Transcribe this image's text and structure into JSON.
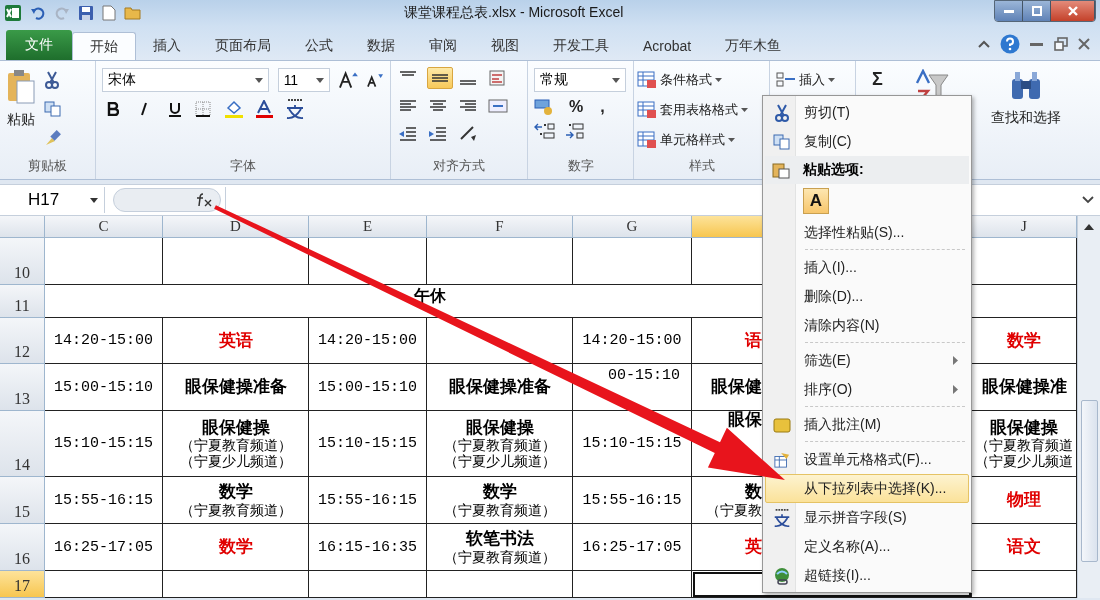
{
  "window": {
    "title": "课堂课程总表.xlsx - Microsoft Excel"
  },
  "tabs": [
    {
      "label": "文件",
      "kind": "file",
      "selected": false
    },
    {
      "label": "开始",
      "kind": "tab",
      "selected": true
    },
    {
      "label": "插入",
      "kind": "tab",
      "selected": false
    },
    {
      "label": "页面布局",
      "kind": "tab",
      "selected": false
    },
    {
      "label": "公式",
      "kind": "tab",
      "selected": false
    },
    {
      "label": "数据",
      "kind": "tab",
      "selected": false
    },
    {
      "label": "审阅",
      "kind": "tab",
      "selected": false
    },
    {
      "label": "视图",
      "kind": "tab",
      "selected": false
    },
    {
      "label": "开发工具",
      "kind": "tab",
      "selected": false
    },
    {
      "label": "Acrobat",
      "kind": "tab",
      "selected": false
    },
    {
      "label": "万年木鱼",
      "kind": "tab",
      "selected": false
    }
  ],
  "ribbon": {
    "clipboard": {
      "paste": "粘贴",
      "label": "剪贴板"
    },
    "font": {
      "name": "宋体",
      "size": "11",
      "label": "字体"
    },
    "alignment": {
      "label": "对齐方式",
      "center_selected": true
    },
    "number": {
      "format": "常规",
      "percent": "%",
      "comma": ",",
      "label": "数字"
    },
    "styles": {
      "buttons": [
        "条件格式",
        "套用表格格式",
        "单元格样式"
      ],
      "label": "样式"
    },
    "cells": {
      "insert": "插入"
    },
    "editing": {
      "sum": "Σ",
      "find": "查找和选择"
    }
  },
  "formula_bar": {
    "name_box": "H17"
  },
  "columns": [
    {
      "label": "C",
      "selected": false
    },
    {
      "label": "D",
      "selected": false
    },
    {
      "label": "E",
      "selected": false
    },
    {
      "label": "F",
      "selected": false
    },
    {
      "label": "G",
      "selected": false
    },
    {
      "selected": true
    },
    {
      "label": "J",
      "selected": false
    }
  ],
  "rows": [
    {
      "number": "10",
      "selected": false,
      "cells": [
        {
          "kind": "empty",
          "selected": false
        },
        {
          "kind": "empty",
          "selected": false
        },
        {
          "kind": "empty",
          "selected": false
        },
        {
          "kind": "empty",
          "selected": false
        },
        {
          "kind": "empty",
          "selected": false
        },
        {
          "kind": "empty",
          "selected": false
        },
        {
          "kind": "empty",
          "selected": false
        }
      ]
    },
    {
      "number": "11",
      "selected": false,
      "cells": [
        {
          "kind": "merged",
          "text": "午休",
          "selected": false
        }
      ]
    },
    {
      "number": "12",
      "selected": false,
      "cells": [
        {
          "kind": "time",
          "text": "14:20-15:00",
          "selected": false
        },
        {
          "kind": "subject",
          "text": "英语",
          "color": "#e00000",
          "selected": false
        },
        {
          "kind": "time",
          "text": "14:20-15:00",
          "selected": false
        },
        {
          "kind": "empty",
          "selected": false
        },
        {
          "kind": "time",
          "text": "14:20-15:00",
          "selected": false
        },
        {
          "kind": "subject",
          "text": "语",
          "color": "#e00000",
          "selected": false
        },
        {
          "kind": "subject",
          "text": "数学",
          "color": "#e00000",
          "selected": false
        }
      ]
    },
    {
      "number": "13",
      "selected": false,
      "cells": [
        {
          "kind": "time",
          "text": "15:00-15:10",
          "selected": false
        },
        {
          "kind": "subject",
          "text": "眼保健操准备",
          "color": "#000000",
          "selected": false
        },
        {
          "kind": "time",
          "text": "15:00-15:10",
          "selected": false
        },
        {
          "kind": "subject",
          "text": "眼保健操准备",
          "color": "#000000",
          "selected": false
        },
        {
          "kind": "partial",
          "text": "00-15:10",
          "selected": false
        },
        {
          "kind": "subject",
          "text": "眼保健",
          "color": "#000000",
          "selected": false
        },
        {
          "kind": "subject",
          "text": "眼保健操准",
          "color": "#000000",
          "selected": false
        }
      ]
    },
    {
      "number": "14",
      "selected": false,
      "cells": [
        {
          "kind": "time",
          "text": "15:10-15:15",
          "selected": false
        },
        {
          "kind": "subject",
          "text": "眼保健操",
          "color": "#000000",
          "notes": [
            "（宁夏教育频道）",
            "（宁夏少儿频道）"
          ],
          "selected": false
        },
        {
          "kind": "time",
          "text": "15:10-15:15",
          "selected": false
        },
        {
          "kind": "subject",
          "text": "眼保健操",
          "color": "#000000",
          "notes": [
            "（宁夏教育频道）",
            "（宁夏少儿频道）"
          ],
          "selected": false
        },
        {
          "kind": "time",
          "text": "15:10-15:15",
          "selected": false
        },
        {
          "kind": "partial",
          "text": "眼保",
          "selected": false
        },
        {
          "kind": "subject",
          "text": "眼保健操",
          "color": "#000000",
          "notes": [
            "（宁夏教育频道",
            "（宁夏少儿频道"
          ],
          "selected": false
        }
      ]
    },
    {
      "number": "15",
      "selected": false,
      "cells": [
        {
          "kind": "time",
          "text": "15:55-16:15",
          "selected": false
        },
        {
          "kind": "subject",
          "text": "数学",
          "color": "#000000",
          "notes": [
            "（宁夏教育频道）"
          ],
          "selected": false
        },
        {
          "kind": "time",
          "text": "15:55-16:15",
          "selected": false
        },
        {
          "kind": "subject",
          "text": "数学",
          "color": "#000000",
          "notes": [
            "（宁夏教育频道）"
          ],
          "selected": false
        },
        {
          "kind": "time",
          "text": "15:55-16:15",
          "selected": false
        },
        {
          "kind": "subject",
          "text": "数",
          "color": "#000000",
          "notes": [
            "（宁夏教"
          ],
          "selected": false
        },
        {
          "kind": "subject",
          "text": "物理",
          "color": "#e00000",
          "selected": false
        }
      ]
    },
    {
      "number": "16",
      "selected": false,
      "cells": [
        {
          "kind": "time",
          "text": "16:25-17:05",
          "selected": false
        },
        {
          "kind": "subject",
          "text": "数学",
          "color": "#e00000",
          "selected": false
        },
        {
          "kind": "time",
          "text": "16:15-16:35",
          "selected": false
        },
        {
          "kind": "subject",
          "text": "软笔书法",
          "color": "#000000",
          "notes": [
            "（宁夏教育频道）"
          ],
          "selected": false
        },
        {
          "kind": "time",
          "text": "16:25-17:05",
          "selected": false
        },
        {
          "kind": "subject",
          "text": "英",
          "color": "#e00000",
          "selected": false
        },
        {
          "kind": "subject",
          "text": "语文",
          "color": "#e00000",
          "selected": false
        }
      ]
    },
    {
      "number": "17",
      "selected": true,
      "cells": [
        {
          "kind": "empty",
          "selected": false
        },
        {
          "kind": "empty",
          "selected": false
        },
        {
          "kind": "empty",
          "selected": false
        },
        {
          "kind": "empty",
          "selected": false
        },
        {
          "kind": "empty",
          "selected": false
        },
        {
          "kind": "empty",
          "selected": true
        },
        {
          "kind": "empty",
          "selected": false
        }
      ]
    }
  ],
  "context_menu": {
    "items": [
      {
        "kind": "item",
        "label": "剪切(T)",
        "highlighted": false,
        "submenu": false
      },
      {
        "kind": "item",
        "label": "复制(C)",
        "highlighted": false,
        "submenu": false
      },
      {
        "kind": "header",
        "label": "粘贴选项:"
      },
      {
        "kind": "paste_button",
        "label": "A"
      },
      {
        "kind": "item",
        "label": "选择性粘贴(S)...",
        "highlighted": false,
        "submenu": false
      },
      {
        "kind": "separator"
      },
      {
        "kind": "item",
        "label": "插入(I)...",
        "highlighted": false,
        "submenu": false
      },
      {
        "kind": "item",
        "label": "删除(D)...",
        "highlighted": false,
        "submenu": false
      },
      {
        "kind": "item",
        "label": "清除内容(N)",
        "highlighted": false,
        "submenu": false
      },
      {
        "kind": "separator"
      },
      {
        "kind": "item",
        "label": "筛选(E)",
        "highlighted": false,
        "submenu": true
      },
      {
        "kind": "item",
        "label": "排序(O)",
        "highlighted": false,
        "submenu": true
      },
      {
        "kind": "separator"
      },
      {
        "kind": "item",
        "label": "插入批注(M)",
        "highlighted": false,
        "submenu": false
      },
      {
        "kind": "separator"
      },
      {
        "kind": "item",
        "label": "设置单元格格式(F)...",
        "highlighted": false,
        "submenu": false
      },
      {
        "kind": "item",
        "label": "从下拉列表中选择(K)...",
        "highlighted": true,
        "submenu": false
      },
      {
        "kind": "item",
        "label": "显示拼音字段(S)",
        "highlighted": false,
        "submenu": false
      },
      {
        "kind": "item",
        "label": "定义名称(A)...",
        "highlighted": false,
        "submenu": false
      },
      {
        "kind": "item",
        "label": "超链接(I)...",
        "highlighted": false,
        "submenu": false
      }
    ]
  }
}
